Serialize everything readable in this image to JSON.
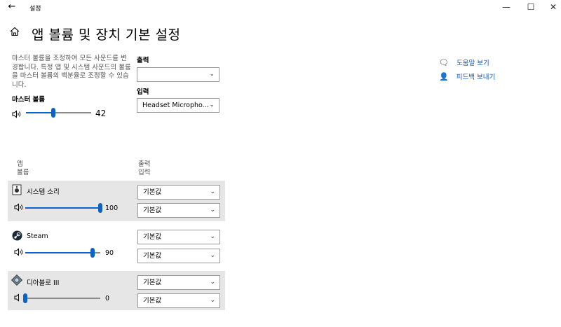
{
  "window": {
    "title": "설정",
    "back_icon": "arrow-left-icon",
    "minimize": "—",
    "maximize": "☐",
    "close": "✕"
  },
  "header": {
    "title": "앱 볼륨 및 장치 기본 설정",
    "home_icon": "home-icon"
  },
  "master": {
    "description": "마스터 볼륨을 조정하여 모든 사운드를 변경합니다. 특정 앱 및 시스템 사운드의 볼륨을 마스터 볼륨의 백분율로 조정할 수 있습니다.",
    "label": "마스터 볼륨",
    "value": 42,
    "value_text": "42"
  },
  "devices": {
    "output_label": "출력",
    "output_value": "",
    "input_label": "입력",
    "input_value": "Headset Micropho..."
  },
  "links": [
    {
      "label": "도움말 보기",
      "icon": "help-chat-icon"
    },
    {
      "label": "피드백 보내기",
      "icon": "feedback-icon"
    }
  ],
  "table_headers": {
    "app": "앱",
    "volume": "볼륨",
    "output": "출력",
    "input": "입력"
  },
  "apps": [
    {
      "name": "시스템 소리",
      "icon": "system-sounds-icon",
      "volume": 100,
      "volume_text": "100",
      "output": "기본값",
      "input": "기본값",
      "highlighted": true
    },
    {
      "name": "Steam",
      "icon": "steam-icon",
      "volume": 90,
      "volume_text": "90",
      "output": "기본값",
      "input": "기본값",
      "highlighted": false
    },
    {
      "name": "디아블로 III",
      "icon": "diablo-icon",
      "volume": 0,
      "volume_text": "0",
      "output": "기본값",
      "input": "기본값",
      "highlighted": true
    }
  ],
  "colors": {
    "accent": "#0a64c8",
    "row_highlight": "#e6e6e6",
    "link": "#0a58b8"
  }
}
